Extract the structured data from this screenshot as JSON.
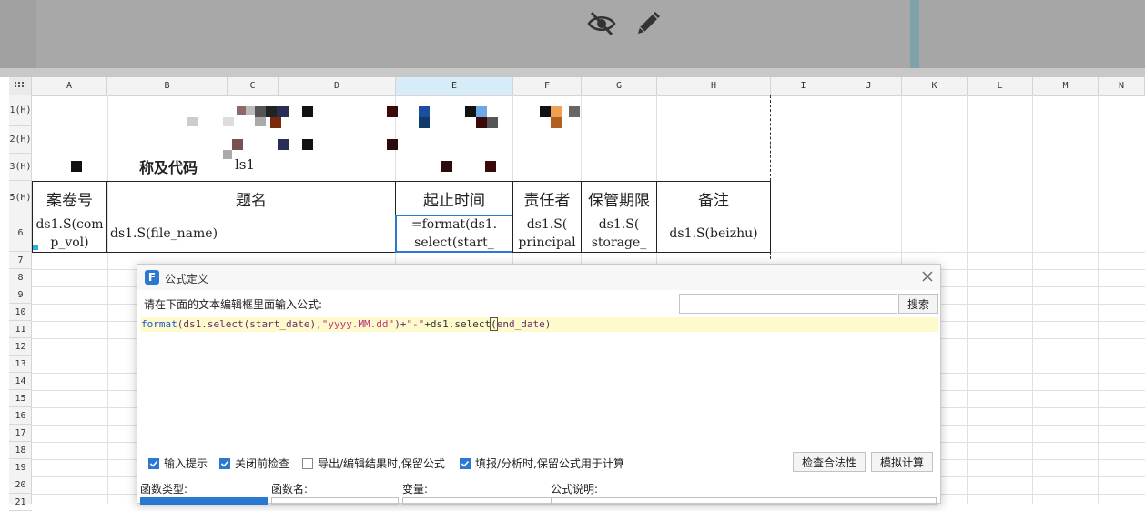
{
  "toolbar": {
    "hide_icon": "eye-slash-icon",
    "edit_icon": "pencil-icon"
  },
  "grid": {
    "corner_icon": "grid-select-icon",
    "columns": [
      "A",
      "B",
      "C",
      "D",
      "E",
      "F",
      "G",
      "H",
      "I",
      "J",
      "K",
      "L",
      "M",
      "N"
    ],
    "rows": [
      "1(H)",
      "2(H)",
      "3(H)",
      "5(H)",
      "6",
      "7",
      "8",
      "9",
      "10",
      "11",
      "12",
      "13",
      "14",
      "15",
      "16",
      "17",
      "18",
      "19",
      "20",
      "21"
    ],
    "row3_text": "称及代码",
    "row3_value": "ls1",
    "headers": [
      "案卷号",
      "题名",
      "起止时间",
      "责任者",
      "保管期限",
      "备注"
    ],
    "data_row": [
      "ds1.S(com\np_vol)",
      "ds1.S(file_name)",
      "=format(ds1.\nselect(start_",
      "ds1.S(\nprincipal",
      "ds1.S(\nstorage_",
      "ds1.S(beizhu)"
    ]
  },
  "dialog": {
    "title": "公式定义",
    "logo_letter": "F",
    "prompt": "请在下面的文本编辑框里面输入公式:",
    "search_placeholder": "",
    "search_button": "搜索",
    "formula": {
      "p1": "format",
      "p2": "(ds1.select(start_date),",
      "p3": "\"yyyy.MM.dd\"",
      "p4": ")+",
      "p5": "\"-\"",
      "p6": "+ds1.select",
      "p7": "(",
      "p8": "end_date)"
    },
    "options": [
      {
        "label": "输入提示",
        "checked": true
      },
      {
        "label": "关闭前检查",
        "checked": true
      },
      {
        "label": "导出/编辑结果时,保留公式",
        "checked": false
      },
      {
        "label": "填报/分析时,保留公式用于计算",
        "checked": true
      }
    ],
    "check_button": "检查合法性",
    "simulate_button": "模拟计算",
    "footer": {
      "function_type": "函数类型:",
      "function_name": "函数名:",
      "variable": "变量:",
      "description": "公式说明:"
    }
  },
  "colors": {
    "accent": "#2b78d0",
    "formula_bg": "#fdfbcc",
    "selected_cell": "#2b78d0"
  }
}
